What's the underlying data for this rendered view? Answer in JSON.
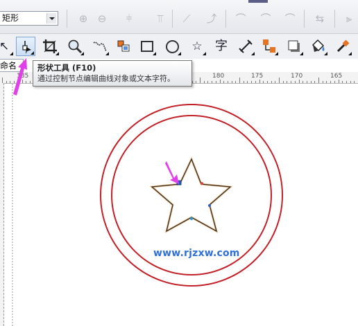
{
  "property_bar": {
    "shape_combo_value": "矩形",
    "buttons": [
      "add-node",
      "delete-node",
      "join-nodes",
      "break-curve",
      "to-line",
      "to-curve",
      "cusp-node",
      "smooth-node",
      "symmetric-node",
      "reverse-direction",
      "extend-curve"
    ]
  },
  "toolbox": {
    "tools": [
      {
        "name": "pick-tool",
        "glyph": "↖"
      },
      {
        "name": "shape-tool",
        "glyph": "▸"
      },
      {
        "name": "crop-tool",
        "glyph": "⌗"
      },
      {
        "name": "zoom-tool",
        "glyph": "🔍"
      },
      {
        "name": "freehand-tool",
        "glyph": "⌇"
      },
      {
        "name": "smart-fill-tool",
        "glyph": "◈"
      },
      {
        "name": "rectangle-tool",
        "glyph": ""
      },
      {
        "name": "ellipse-tool",
        "glyph": ""
      },
      {
        "name": "polygon-star-tool",
        "glyph": "☆"
      },
      {
        "name": "text-tool",
        "glyph": "字"
      },
      {
        "name": "dimension-tool",
        "glyph": "⤢"
      },
      {
        "name": "connector-tool",
        "glyph": ""
      },
      {
        "name": "drop-shadow-tool",
        "glyph": "▣"
      },
      {
        "name": "fill-tool",
        "glyph": "⛉"
      },
      {
        "name": "eyedropper-tool",
        "glyph": "✎"
      }
    ],
    "active_tool": "shape-tool"
  },
  "document_tab": {
    "label": "命名"
  },
  "ruler": {
    "labels": [
      "185",
      "180",
      "175",
      "170",
      "165"
    ]
  },
  "tooltip": {
    "title": "形状工具 (F10)",
    "description": "通过控制节点编辑曲线对象或文本字符。"
  },
  "canvas": {
    "watermark_text": "www.rjzxw.com",
    "colors": {
      "circle_stroke": "#c21f26",
      "star_stroke": "#3a2a1e",
      "arrow": "#e040e8",
      "node_handle": "#1d5fd1"
    }
  }
}
